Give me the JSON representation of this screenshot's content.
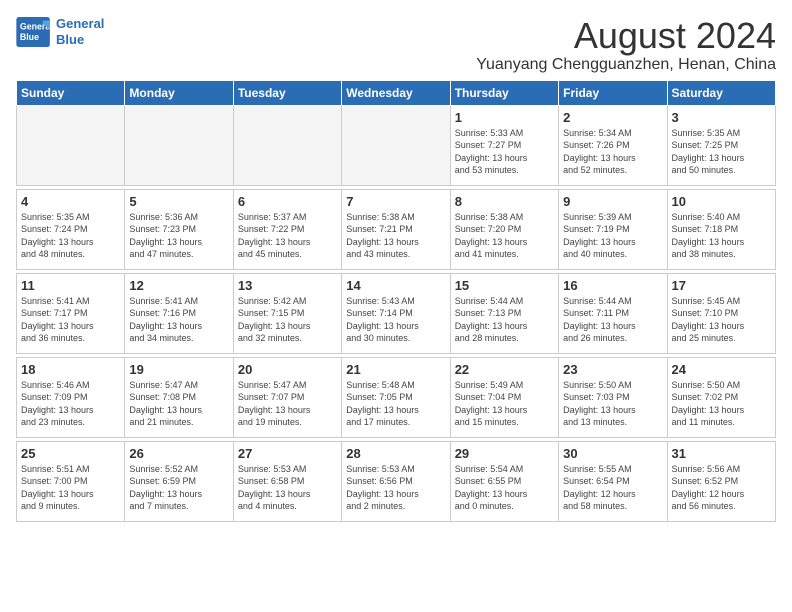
{
  "logo": {
    "line1": "General",
    "line2": "Blue"
  },
  "title": "August 2024",
  "location": "Yuanyang Chengguanzhen, Henan, China",
  "days_of_week": [
    "Sunday",
    "Monday",
    "Tuesday",
    "Wednesday",
    "Thursday",
    "Friday",
    "Saturday"
  ],
  "weeks": [
    [
      {
        "day": "",
        "info": ""
      },
      {
        "day": "",
        "info": ""
      },
      {
        "day": "",
        "info": ""
      },
      {
        "day": "",
        "info": ""
      },
      {
        "day": "1",
        "info": "Sunrise: 5:33 AM\nSunset: 7:27 PM\nDaylight: 13 hours\nand 53 minutes."
      },
      {
        "day": "2",
        "info": "Sunrise: 5:34 AM\nSunset: 7:26 PM\nDaylight: 13 hours\nand 52 minutes."
      },
      {
        "day": "3",
        "info": "Sunrise: 5:35 AM\nSunset: 7:25 PM\nDaylight: 13 hours\nand 50 minutes."
      }
    ],
    [
      {
        "day": "4",
        "info": "Sunrise: 5:35 AM\nSunset: 7:24 PM\nDaylight: 13 hours\nand 48 minutes."
      },
      {
        "day": "5",
        "info": "Sunrise: 5:36 AM\nSunset: 7:23 PM\nDaylight: 13 hours\nand 47 minutes."
      },
      {
        "day": "6",
        "info": "Sunrise: 5:37 AM\nSunset: 7:22 PM\nDaylight: 13 hours\nand 45 minutes."
      },
      {
        "day": "7",
        "info": "Sunrise: 5:38 AM\nSunset: 7:21 PM\nDaylight: 13 hours\nand 43 minutes."
      },
      {
        "day": "8",
        "info": "Sunrise: 5:38 AM\nSunset: 7:20 PM\nDaylight: 13 hours\nand 41 minutes."
      },
      {
        "day": "9",
        "info": "Sunrise: 5:39 AM\nSunset: 7:19 PM\nDaylight: 13 hours\nand 40 minutes."
      },
      {
        "day": "10",
        "info": "Sunrise: 5:40 AM\nSunset: 7:18 PM\nDaylight: 13 hours\nand 38 minutes."
      }
    ],
    [
      {
        "day": "11",
        "info": "Sunrise: 5:41 AM\nSunset: 7:17 PM\nDaylight: 13 hours\nand 36 minutes."
      },
      {
        "day": "12",
        "info": "Sunrise: 5:41 AM\nSunset: 7:16 PM\nDaylight: 13 hours\nand 34 minutes."
      },
      {
        "day": "13",
        "info": "Sunrise: 5:42 AM\nSunset: 7:15 PM\nDaylight: 13 hours\nand 32 minutes."
      },
      {
        "day": "14",
        "info": "Sunrise: 5:43 AM\nSunset: 7:14 PM\nDaylight: 13 hours\nand 30 minutes."
      },
      {
        "day": "15",
        "info": "Sunrise: 5:44 AM\nSunset: 7:13 PM\nDaylight: 13 hours\nand 28 minutes."
      },
      {
        "day": "16",
        "info": "Sunrise: 5:44 AM\nSunset: 7:11 PM\nDaylight: 13 hours\nand 26 minutes."
      },
      {
        "day": "17",
        "info": "Sunrise: 5:45 AM\nSunset: 7:10 PM\nDaylight: 13 hours\nand 25 minutes."
      }
    ],
    [
      {
        "day": "18",
        "info": "Sunrise: 5:46 AM\nSunset: 7:09 PM\nDaylight: 13 hours\nand 23 minutes."
      },
      {
        "day": "19",
        "info": "Sunrise: 5:47 AM\nSunset: 7:08 PM\nDaylight: 13 hours\nand 21 minutes."
      },
      {
        "day": "20",
        "info": "Sunrise: 5:47 AM\nSunset: 7:07 PM\nDaylight: 13 hours\nand 19 minutes."
      },
      {
        "day": "21",
        "info": "Sunrise: 5:48 AM\nSunset: 7:05 PM\nDaylight: 13 hours\nand 17 minutes."
      },
      {
        "day": "22",
        "info": "Sunrise: 5:49 AM\nSunset: 7:04 PM\nDaylight: 13 hours\nand 15 minutes."
      },
      {
        "day": "23",
        "info": "Sunrise: 5:50 AM\nSunset: 7:03 PM\nDaylight: 13 hours\nand 13 minutes."
      },
      {
        "day": "24",
        "info": "Sunrise: 5:50 AM\nSunset: 7:02 PM\nDaylight: 13 hours\nand 11 minutes."
      }
    ],
    [
      {
        "day": "25",
        "info": "Sunrise: 5:51 AM\nSunset: 7:00 PM\nDaylight: 13 hours\nand 9 minutes."
      },
      {
        "day": "26",
        "info": "Sunrise: 5:52 AM\nSunset: 6:59 PM\nDaylight: 13 hours\nand 7 minutes."
      },
      {
        "day": "27",
        "info": "Sunrise: 5:53 AM\nSunset: 6:58 PM\nDaylight: 13 hours\nand 4 minutes."
      },
      {
        "day": "28",
        "info": "Sunrise: 5:53 AM\nSunset: 6:56 PM\nDaylight: 13 hours\nand 2 minutes."
      },
      {
        "day": "29",
        "info": "Sunrise: 5:54 AM\nSunset: 6:55 PM\nDaylight: 13 hours\nand 0 minutes."
      },
      {
        "day": "30",
        "info": "Sunrise: 5:55 AM\nSunset: 6:54 PM\nDaylight: 12 hours\nand 58 minutes."
      },
      {
        "day": "31",
        "info": "Sunrise: 5:56 AM\nSunset: 6:52 PM\nDaylight: 12 hours\nand 56 minutes."
      }
    ]
  ]
}
